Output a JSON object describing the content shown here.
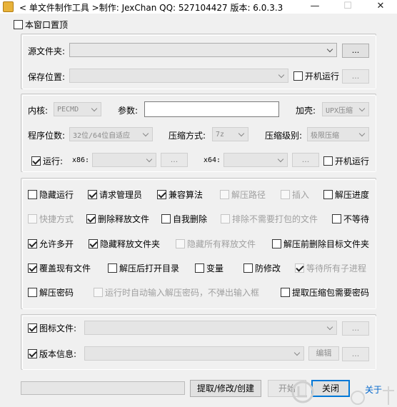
{
  "window": {
    "title": "< 单文件制作工具 >制作: JexChan  QQ: 527104427  版本: 6.0.3.3",
    "min_glyph": "—",
    "max_glyph": "☐",
    "close_glyph": "✕"
  },
  "topmost": {
    "label": "本窗口置顶",
    "checked": false
  },
  "source": {
    "folder_label": "源文件夹:",
    "folder_value": "",
    "browse1": "...",
    "save_label": "保存位置:",
    "save_value": "",
    "autorun_label": "开机运行",
    "browse2": "..."
  },
  "settings": {
    "kernel_label": "内核:",
    "kernel_value": "PECMD",
    "params_label": "参数:",
    "params_value": "",
    "shell_label": "加壳:",
    "shell_value": "UPX压缩",
    "bits_label": "程序位数:",
    "bits_value": "32位/64位自适应",
    "compress_label": "压缩方式:",
    "compress_value": "7z",
    "level_label": "压缩级别:",
    "level_value": "极限压缩",
    "run_label": "运行:",
    "x86_label": "x86:",
    "x86_value": "",
    "x86_browse": "...",
    "x64_label": "x64:",
    "x64_value": "",
    "x64_browse": "...",
    "autorun2_label": "开机运行"
  },
  "options": [
    [
      {
        "label": "隐藏运行",
        "checked": false,
        "enabled": true
      },
      {
        "label": "请求管理员",
        "checked": true,
        "enabled": true
      },
      {
        "label": "兼容算法",
        "checked": true,
        "enabled": true
      },
      {
        "label": "解压路径",
        "checked": false,
        "enabled": false
      },
      {
        "label": "插入",
        "checked": false,
        "enabled": false
      },
      {
        "label": "解压进度",
        "checked": false,
        "enabled": true
      }
    ],
    [
      {
        "label": "快捷方式",
        "checked": false,
        "enabled": false
      },
      {
        "label": "删除释放文件",
        "checked": true,
        "enabled": true
      },
      {
        "label": "自我删除",
        "checked": false,
        "enabled": true
      },
      {
        "label": "排除不需要打包的文件",
        "checked": false,
        "enabled": false
      },
      {
        "label": "不等待",
        "checked": false,
        "enabled": true
      }
    ],
    [
      {
        "label": "允许多开",
        "checked": true,
        "enabled": true
      },
      {
        "label": "隐藏释放文件夹",
        "checked": true,
        "enabled": true
      },
      {
        "label": "隐藏所有释放文件",
        "checked": false,
        "enabled": false
      },
      {
        "label": "解压前删除目标文件夹",
        "checked": false,
        "enabled": true
      }
    ],
    [
      {
        "label": "覆盖现有文件",
        "checked": true,
        "enabled": true
      },
      {
        "label": "解压后打开目录",
        "checked": false,
        "enabled": true
      },
      {
        "label": "变量",
        "checked": false,
        "enabled": true
      },
      {
        "label": "防修改",
        "checked": false,
        "enabled": true
      },
      {
        "label": "等待所有子进程",
        "checked": true,
        "enabled": false
      }
    ],
    [
      {
        "label": "解压密码",
        "checked": false,
        "enabled": true
      },
      {
        "label": "运行时自动输入解压密码，不弹出输入框",
        "checked": false,
        "enabled": false
      },
      {
        "label": "提取压缩包需要密码",
        "checked": false,
        "enabled": true
      }
    ]
  ],
  "resources": {
    "icon_label": "图标文件:",
    "icon_value": "",
    "icon_browse": "...",
    "version_label": "版本信息:",
    "version_value": "",
    "edit_label": "编辑",
    "version_browse": "..."
  },
  "footer": {
    "extract_button": "提取/修改/创建",
    "start_button": "开始",
    "close_button": "关闭",
    "about_link": "关于",
    "progress": 0
  },
  "colors": {
    "accent": "#0078d7",
    "link": "#0066cc"
  }
}
